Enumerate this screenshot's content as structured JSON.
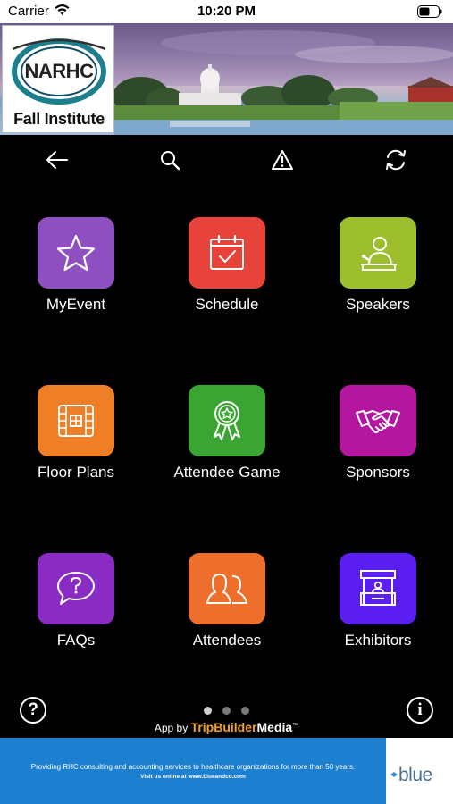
{
  "status_bar": {
    "carrier": "Carrier",
    "time": "10:20 PM"
  },
  "banner": {
    "logo_name": "NARHC",
    "logo_subtitle": "Fall Institute"
  },
  "toolbar": {
    "icons": [
      "back-arrow-icon",
      "search-icon",
      "warning-icon",
      "refresh-icon"
    ]
  },
  "tiles": [
    {
      "label": "MyEvent",
      "color": "#8e4fc0",
      "icon": "star-icon"
    },
    {
      "label": "Schedule",
      "color": "#e8433a",
      "icon": "calendar-check-icon"
    },
    {
      "label": "Speakers",
      "color": "#9dbf2e",
      "icon": "speaker-podium-icon"
    },
    {
      "label": "Floor Plans",
      "color": "#ef7f27",
      "icon": "floor-plan-icon"
    },
    {
      "label": "Attendee Game",
      "color": "#3ba534",
      "icon": "award-ribbon-icon"
    },
    {
      "label": "Sponsors",
      "color": "#b5169f",
      "icon": "handshake-icon"
    },
    {
      "label": "FAQs",
      "color": "#8a2cc4",
      "icon": "question-bubble-icon"
    },
    {
      "label": "Attendees",
      "color": "#ee6f2c",
      "icon": "people-icon"
    },
    {
      "label": "Exhibitors",
      "color": "#5a1ef0",
      "icon": "exhibitor-booth-icon"
    }
  ],
  "footer": {
    "help_symbol": "?",
    "info_symbol": "i",
    "page_count": 3,
    "active_page": 1,
    "app_by_prefix": "App by",
    "app_by_brand_1": "TripBuilder",
    "app_by_brand_2": "Media"
  },
  "ad": {
    "line1": "Providing RHC consulting and accounting services to healthcare organizations for more than 50 years.",
    "line2": "Visit us online at www.blueandco.com",
    "logo_word": "blue"
  }
}
